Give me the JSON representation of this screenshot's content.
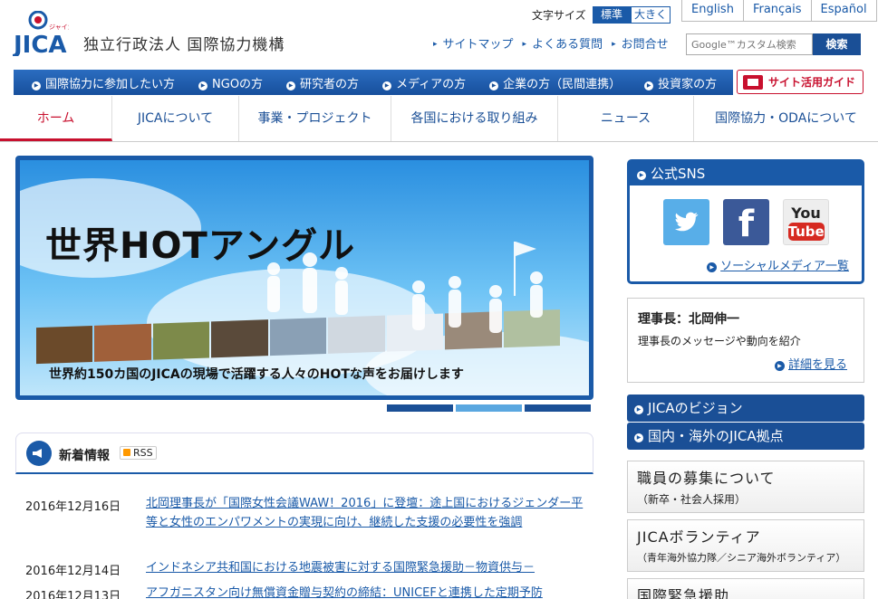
{
  "header": {
    "logo_text": "JICA",
    "logo_sub": "ジャイカ",
    "org_name": "独立行政法人 国際協力機構",
    "font_size_label": "文字サイズ",
    "font_size_options": [
      "標準",
      "大きく"
    ],
    "languages": [
      "English",
      "Français",
      "Español"
    ],
    "util_links": [
      "サイトマップ",
      "よくある質問",
      "お問合せ"
    ],
    "search_placeholder": "Google™カスタム検索",
    "search_button": "検索"
  },
  "audience_bar": {
    "items": [
      "国際協力に参加したい方",
      "NGOの方",
      "研究者の方",
      "メディアの方",
      "企業の方（民間連携）",
      "投資家の方"
    ],
    "guide_button": "サイト活用ガイド"
  },
  "main_nav": {
    "tabs": [
      "ホーム",
      "JICAについて",
      "事業・プロジェクト",
      "各国における取り組み",
      "ニュース",
      "国際協力・ODAについて"
    ],
    "active_index": 0
  },
  "banner": {
    "title": "世界HOTアングル",
    "subtitle": "世界約150カ国のJICAの現場で活躍する人々のHOTな声をお届けします",
    "slide_count": 3,
    "active_slide": 1
  },
  "news": {
    "title": "新着情報",
    "rss_label": "RSS",
    "items": [
      {
        "date": "2016年12月16日",
        "text": "北岡理事長が「国際女性会議WAW！2016」に登壇：途上国におけるジェンダー平等と女性のエンパワメントの実現に向け、継続した支援の必要性を強調"
      },
      {
        "date": "2016年12月14日",
        "text": "インドネシア共和国における地震被害に対する国際緊急援助－物資供与－"
      },
      {
        "date": "2016年12月13日",
        "text": "アフガニスタン向け無償資金贈与契約の締結：UNICEFと連携した定期予防"
      }
    ]
  },
  "sidebar": {
    "sns": {
      "title": "公式SNS",
      "icons": [
        "twitter-icon",
        "facebook-icon",
        "youtube-icon"
      ],
      "youtube_label_top": "You",
      "youtube_label_bottom": "Tube",
      "more_link": "ソーシャルメディア一覧"
    },
    "president": {
      "title": "理事長：北岡伸一",
      "desc": "理事長のメッセージや動向を紹介",
      "more_link": "詳細を見る"
    },
    "blue_links": [
      "JICAのビジョン",
      "国内・海外のJICA拠点"
    ],
    "grey_links": [
      {
        "title": "職員の募集について",
        "sub": "（新卒・社会人採用）"
      },
      {
        "title": "JICAボランティア",
        "sub": "（青年海外協力隊／シニア海外ボランティア）"
      },
      {
        "title": "国際緊急援助",
        "sub": ""
      }
    ]
  },
  "colors": {
    "primary": "#1a5aa8",
    "accent_red": "#c8102e"
  }
}
